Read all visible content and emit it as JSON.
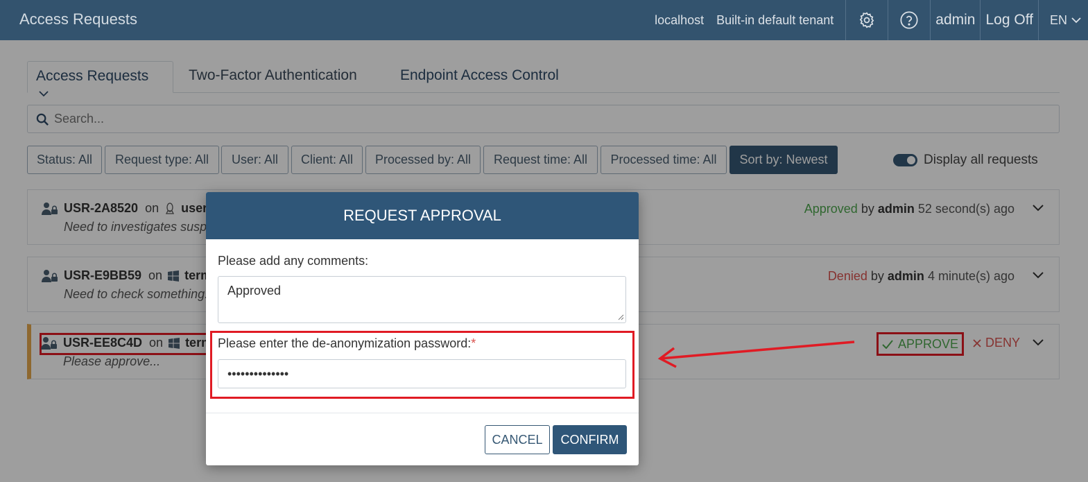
{
  "header": {
    "app_title": "Access Requests",
    "host": "localhost",
    "tenant": "Built-in default tenant",
    "user": "admin",
    "logoff": "Log Off",
    "language": "EN"
  },
  "tabs": [
    {
      "label": "Access Requests"
    },
    {
      "label": "Two-Factor Authentication"
    },
    {
      "label": "Endpoint Access Control"
    }
  ],
  "search": {
    "placeholder": "Search..."
  },
  "filters": [
    "Status: All",
    "Request type: All",
    "User: All",
    "Client: All",
    "Processed by: All",
    "Request time: All",
    "Processed time: All",
    "Sort by: Newest"
  ],
  "display_all_label": "Display all requests",
  "requests": [
    {
      "id": "USR-2A8520",
      "on": "on",
      "host": "user",
      "os_icon": "linux-icon",
      "comment": "Need to investigates suspic",
      "status_word": "Approved",
      "by": "by",
      "by_user": "admin",
      "time": "52 second(s) ago"
    },
    {
      "id": "USR-E9BB59",
      "on": "on",
      "host": "term",
      "os_icon": "windows-icon",
      "comment": "Need to check something...",
      "status_word": "Denied",
      "by": "by",
      "by_user": "admin",
      "time": "4 minute(s) ago"
    },
    {
      "id": "USR-EE8C4D",
      "on": "on",
      "host": "term",
      "os_icon": "windows-icon",
      "comment": "Please approve...",
      "approve_label": "APPROVE",
      "deny_label": "DENY"
    }
  ],
  "modal": {
    "title": "REQUEST APPROVAL",
    "comments_label": "Please add any comments:",
    "comments_value": "Approved",
    "password_label": "Please enter the de-anonymization password:",
    "required_mark": "*",
    "password_mask": "••••••••••••••",
    "cancel_label": "CANCEL",
    "confirm_label": "CONFIRM"
  },
  "colors": {
    "header_bg": "#365874",
    "modal_header_bg": "#2f5678",
    "approved": "#4ea74e",
    "denied": "#d9534f",
    "highlight": "#e01b24",
    "pending_accent": "#e6a84c"
  }
}
